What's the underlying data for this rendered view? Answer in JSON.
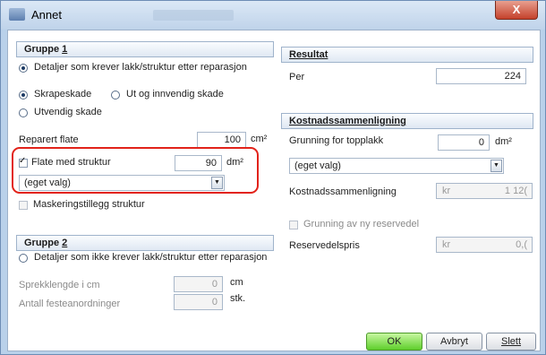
{
  "window": {
    "title": "Annet",
    "close_label": "X"
  },
  "group1": {
    "header_prefix": "Gruppe ",
    "header_num": "1",
    "option_label": "Detaljer som krever lakk/struktur etter reparasjon",
    "damage_options": [
      "Skrapeskade",
      "Ut og innvendig skade",
      "Utvendig skade"
    ],
    "repaired_area": {
      "label": "Reparert flate",
      "value": "100",
      "unit": "cm²"
    },
    "structure_area": {
      "label": "Flate med struktur",
      "value": "90",
      "unit": "dm²"
    },
    "structure_select": "(eget valg)",
    "masking_label": "Maskeringstillegg struktur"
  },
  "group2": {
    "header_prefix": "Gruppe ",
    "header_num": "2",
    "option_label": "Detaljer som ikke krever lakk/struktur etter reparasjon",
    "crack_length": {
      "label": "Sprekklengde i cm",
      "value": "0",
      "unit": "cm"
    },
    "fasteners": {
      "label": "Antall festeanordninger",
      "value": "0",
      "unit": "stk."
    }
  },
  "result": {
    "header": "Resultat",
    "per_label": "Per",
    "per_value": "224"
  },
  "cost": {
    "header": "Kostnadssammenligning",
    "primer_label": "Grunning for topplakk",
    "primer_value": "0",
    "primer_unit": "dm²",
    "primer_select": "(eget valg)",
    "compare_label": "Kostnadssammenligning",
    "compare_prefix": "kr",
    "compare_value": "1 12(",
    "new_part_label": "Grunning av ny reservedel",
    "spare_label": "Reservedelspris",
    "spare_prefix": "kr",
    "spare_value": "0,("
  },
  "buttons": {
    "ok": "OK",
    "cancel": "Avbryt",
    "delete": "Slett"
  }
}
